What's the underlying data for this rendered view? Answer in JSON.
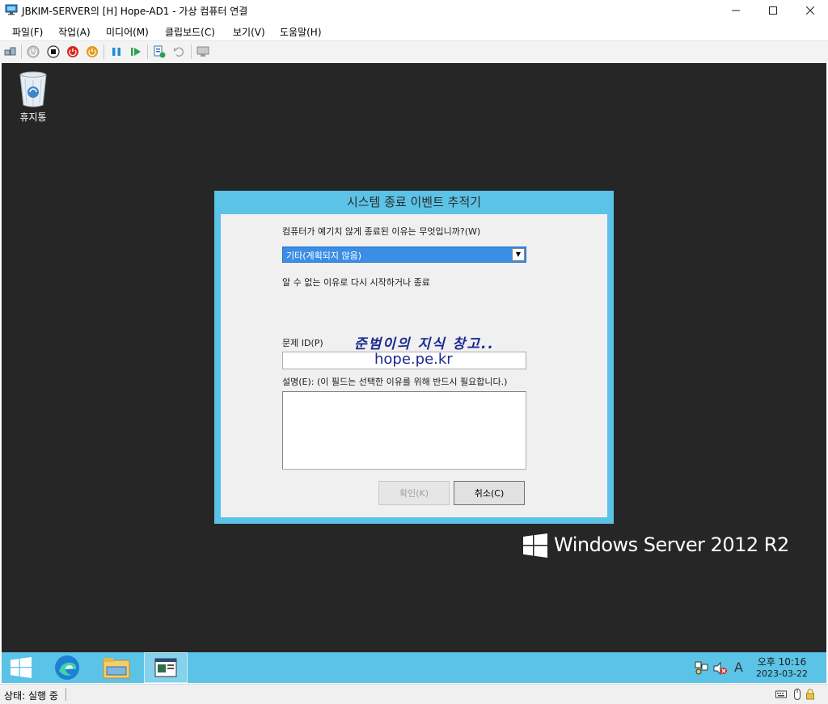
{
  "window": {
    "title": "JBKIM-SERVER의 [H] Hope-AD1 - 가상 컴퓨터 연결",
    "minimize": "—",
    "maximize": "☐",
    "close": "✕"
  },
  "menu": {
    "items": [
      "파일(F)",
      "작업(A)",
      "미디어(M)",
      "클립보드(C)",
      "보기(V)",
      "도움말(H)"
    ]
  },
  "toolbar": {
    "icons": [
      "ctrl-alt-del-icon",
      "start-icon",
      "turn-off-icon",
      "shutdown-icon",
      "save-state-icon",
      "pause-icon",
      "resume-icon",
      "checkpoint-icon",
      "revert-icon",
      "enhanced-session-icon"
    ]
  },
  "desktop": {
    "recycle_bin_label": "휴지통"
  },
  "dialog": {
    "title": "시스템 종료 이벤트 추적기",
    "question": "컴퓨터가 예기치 않게 종료된 이유는 무엇입니까?(W)",
    "selected_reason": "기타(계획되지 않음)",
    "reason_description": "알 수 없는 이유로 다시 시작하거나 종료",
    "problem_id_label": "문제 ID(P)",
    "problem_id_value": "",
    "description_label": "설명(E): (이 필드는 선택한 이유를 위해 반드시 필요합니다.)",
    "description_value": "",
    "ok_button": "확인(K)",
    "cancel_button": "취소(C)"
  },
  "watermark": {
    "name": "준범이의 지식 창고..",
    "url": "hope.pe.kr"
  },
  "brand": {
    "text": "Windows Server 2012 R2"
  },
  "taskbar": {
    "time": "오후 10:16",
    "date": "2023-03-22",
    "ime_indicator": "A"
  },
  "statusbar": {
    "status": "상태: 실행 중"
  },
  "colors": {
    "accent": "#5bc3e6",
    "desktop": "#262626",
    "selection": "#3a8ee6",
    "watermark": "#1a2b8f"
  }
}
